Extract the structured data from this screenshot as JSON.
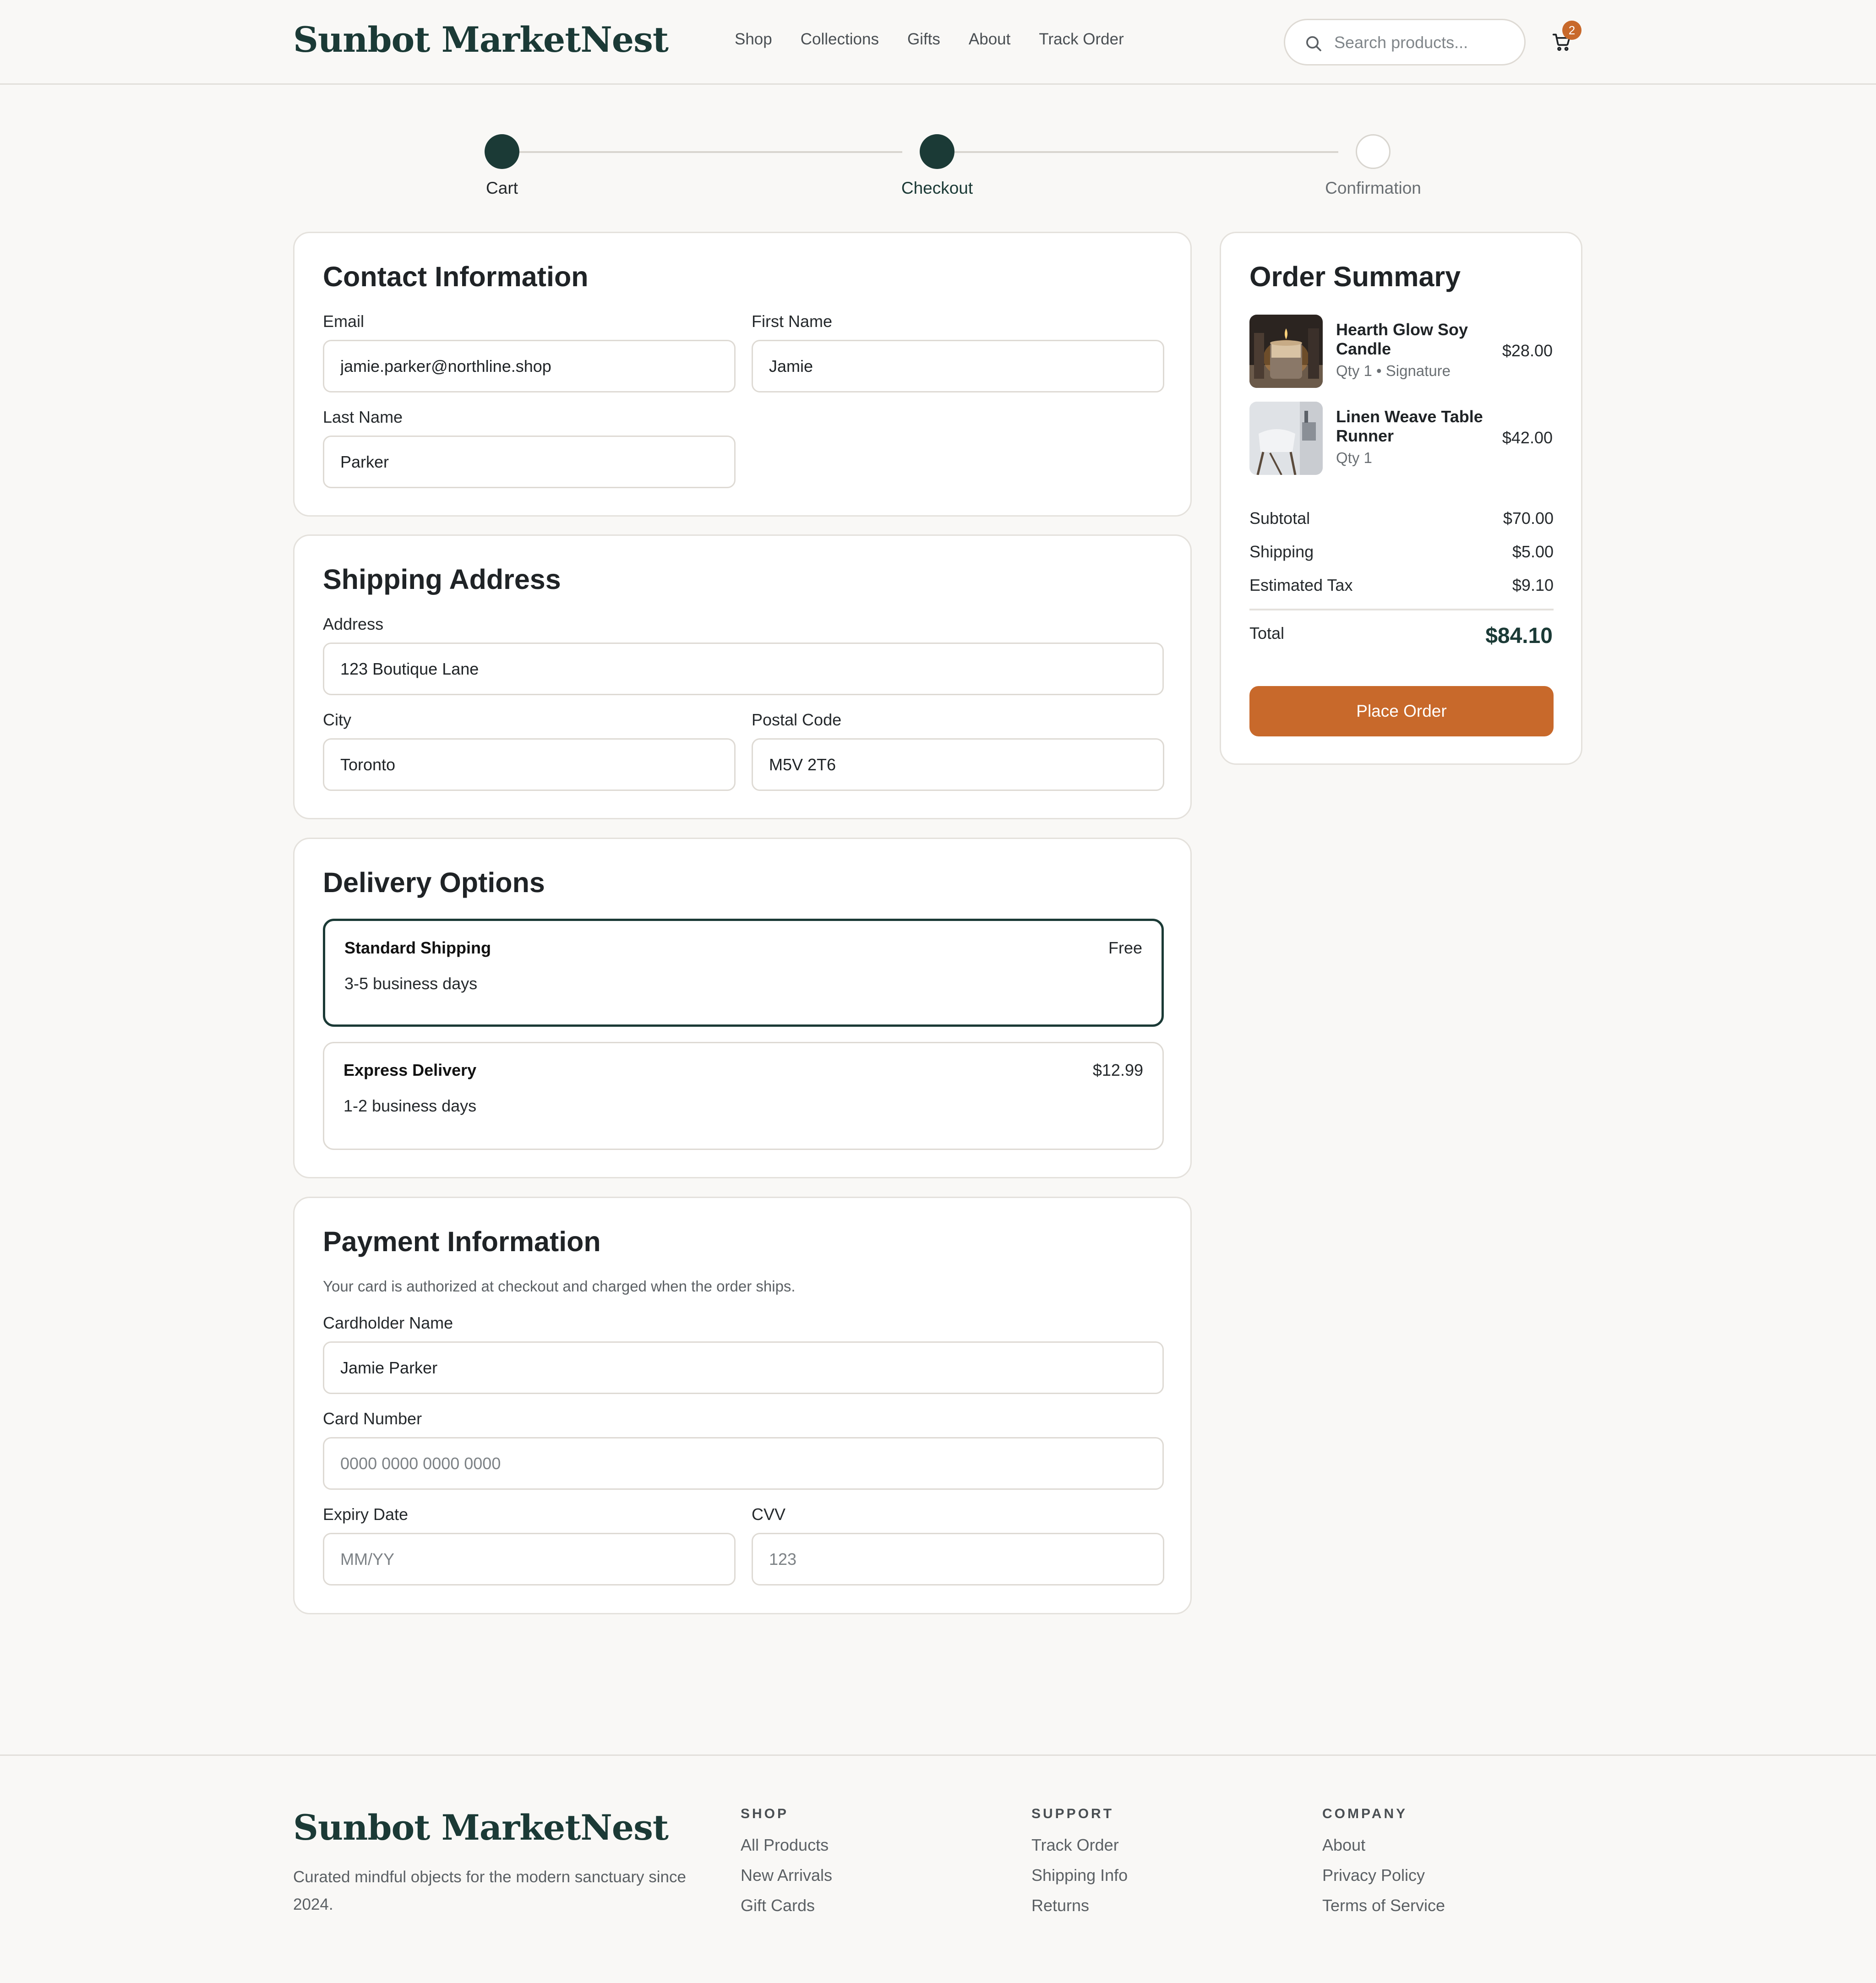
{
  "brand": {
    "name": "Sunbot MarketNest",
    "accent": "#1b3a36",
    "action": "#c8692b"
  },
  "nav": [
    "Shop",
    "Collections",
    "Gifts",
    "About",
    "Track Order"
  ],
  "search": {
    "placeholder": "Search products...",
    "icon": "search-icon"
  },
  "cart": {
    "icon": "cart-icon",
    "count": "2"
  },
  "steps": [
    {
      "label": "Cart",
      "state": "done"
    },
    {
      "label": "Checkout",
      "state": "done"
    },
    {
      "label": "Confirmation",
      "state": "todo"
    }
  ],
  "contact": {
    "title": "Contact Information",
    "email_label": "Email",
    "email": "jamie.parker@northline.shop",
    "first_label": "First Name",
    "first": "Jamie",
    "last_label": "Last Name",
    "last": "Parker"
  },
  "shipping": {
    "title": "Shipping Address",
    "address_label": "Address",
    "address": "123 Boutique Lane",
    "city_label": "City",
    "city": "Toronto",
    "postal_label": "Postal Code",
    "postal": "M5V 2T6"
  },
  "delivery": {
    "title": "Delivery Options",
    "options": [
      {
        "name": "Standard Shipping",
        "days": "3-5 business days",
        "price": "Free",
        "selected": true
      },
      {
        "name": "Express Delivery",
        "days": "1-2 business days",
        "price": "$12.99",
        "selected": false
      }
    ]
  },
  "payment": {
    "title": "Payment Information",
    "note": "Your card is authorized at checkout and charged when the order ships.",
    "holder_label": "Cardholder Name",
    "holder": "Jamie Parker",
    "number_label": "Card Number",
    "number_placeholder": "0000 0000 0000 0000",
    "expiry_label": "Expiry Date",
    "expiry_placeholder": "MM/YY",
    "cvv_label": "CVV",
    "cvv_placeholder": "123"
  },
  "summary": {
    "title": "Order Summary",
    "items": [
      {
        "name": "Hearth Glow Soy Candle",
        "meta": "Qty 1 • Signature",
        "price": "$28.00"
      },
      {
        "name": "Linen Weave Table Runner",
        "meta": "Qty 1",
        "price": "$42.00"
      }
    ],
    "subtotal_label": "Subtotal",
    "subtotal": "$70.00",
    "shipping_label": "Shipping",
    "shipping": "$5.00",
    "tax_label": "Estimated Tax",
    "tax": "$9.10",
    "total_label": "Total",
    "total": "$84.10",
    "button": "Place Order"
  },
  "footer": {
    "tagline": "Curated mindful objects for the modern sanctuary since 2024.",
    "columns": [
      {
        "heading": "SHOP",
        "links": [
          "All Products",
          "New Arrivals",
          "Gift Cards"
        ]
      },
      {
        "heading": "SUPPORT",
        "links": [
          "Track Order",
          "Shipping Info",
          "Returns"
        ]
      },
      {
        "heading": "COMPANY",
        "links": [
          "About",
          "Privacy Policy",
          "Terms of Service"
        ]
      }
    ]
  }
}
